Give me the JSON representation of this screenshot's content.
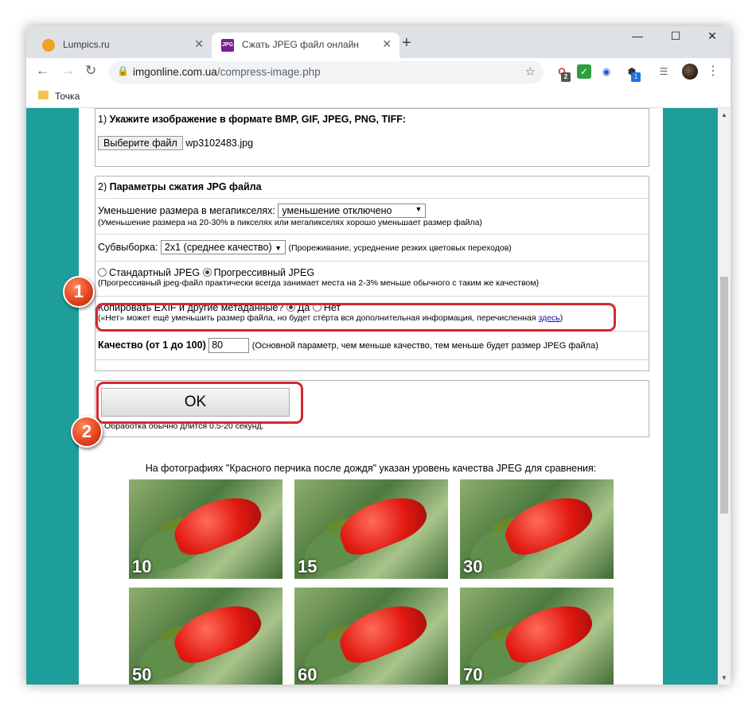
{
  "browser": {
    "tabs": [
      {
        "label": "Lumpics.ru",
        "active": false
      },
      {
        "label": "Сжать JPEG файл онлайн - IMG",
        "active": true,
        "favicon_text": "JPG"
      }
    ],
    "new_tab": "+",
    "window_controls": {
      "minimize": "—",
      "maximize": "☐",
      "close": "✕"
    },
    "url_domain": "imgonline.com.ua",
    "url_path": "/compress-image.php",
    "extension_badges": [
      "2",
      "1"
    ],
    "bookmark": "Точка"
  },
  "form": {
    "section1_number": "1)",
    "section1_title": "Укажите изображение в формате BMP, GIF, JPEG, PNG, TIFF:",
    "choose_file_button": "Выберите файл",
    "file_name": "wp3102483.jpg",
    "section2_number": "2)",
    "section2_title": "Параметры сжатия JPG файла",
    "megapixel_label": "Уменьшение размера в мегапикселях:",
    "megapixel_value": "уменьшение отключено",
    "megapixel_hint": "(Уменьшение размера на 20-30% в пикселях или мегапикселях хорошо уменьшает размер файла)",
    "subsampling_label": "Субвыборка:",
    "subsampling_value": "2x1 (среднее качество)",
    "subsampling_hint": "(Прореживание, усреднение резких цветовых переходов)",
    "jpeg_standard": "Стандартный JPEG",
    "jpeg_progressive": "Прогрессивный JPEG",
    "progressive_hint": "(Прогрессивный jpeg-файл практически всегда занимает места на 2-3% меньше обычного с таким же качеством)",
    "exif_label": "Копировать EXIF и другие метаданные?",
    "exif_yes": "Да",
    "exif_no": "Нет",
    "exif_hint": "(«Нет» может ещё уменьшить размер файла, но будет стёрта вся дополнительная информация, перечисленная",
    "exif_link": "здесь",
    "exif_hint_end": ")",
    "quality_label": "Качество (от 1 до 100)",
    "quality_value": "80",
    "quality_hint": "(Основной параметр, чем меньше качество, тем меньше будет размер JPEG файла)",
    "ok_button": "OK",
    "processing_note": "Обработка обычно длится 0.5-20 секунд."
  },
  "markers": [
    "1",
    "2"
  ],
  "samples": {
    "caption": "На фотографиях \"Красного перчика после дождя\" указан уровень качества JPEG для сравнения:",
    "qualities": [
      "10",
      "15",
      "30",
      "50",
      "60",
      "70"
    ]
  }
}
